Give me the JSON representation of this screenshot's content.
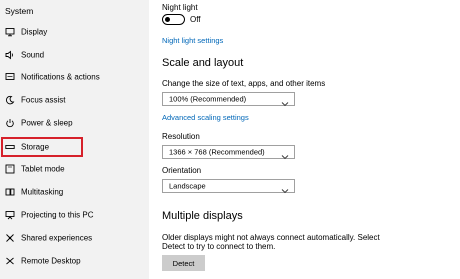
{
  "sidebar": {
    "title": "System",
    "items": [
      {
        "label": "Display",
        "icon": "display-icon"
      },
      {
        "label": "Sound",
        "icon": "sound-icon"
      },
      {
        "label": "Notifications & actions",
        "icon": "notifications-icon"
      },
      {
        "label": "Focus assist",
        "icon": "focus-assist-icon"
      },
      {
        "label": "Power & sleep",
        "icon": "power-icon"
      },
      {
        "label": "Storage",
        "icon": "storage-icon"
      },
      {
        "label": "Tablet mode",
        "icon": "tablet-icon"
      },
      {
        "label": "Multitasking",
        "icon": "multitasking-icon"
      },
      {
        "label": "Projecting to this PC",
        "icon": "projecting-icon"
      },
      {
        "label": "Shared experiences",
        "icon": "shared-experiences-icon"
      },
      {
        "label": "Remote Desktop",
        "icon": "remote-desktop-icon"
      }
    ],
    "highlighted_item": "Storage",
    "highlight_color": "#d6202a"
  },
  "main": {
    "night_light": {
      "label": "Night light",
      "toggle_state": "Off",
      "settings_link": "Night light settings"
    },
    "scale_layout": {
      "heading": "Scale and layout",
      "scale_label": "Change the size of text, apps, and other items",
      "scale_value": "100% (Recommended)",
      "advanced_link": "Advanced scaling settings",
      "resolution_label": "Resolution",
      "resolution_value": "1366 × 768 (Recommended)",
      "orientation_label": "Orientation",
      "orientation_value": "Landscape"
    },
    "multiple_displays": {
      "heading": "Multiple displays",
      "description_line1": "Older displays might not always connect automatically. Select",
      "description_line2": "Detect to try to connect to them.",
      "detect_button": "Detect"
    }
  },
  "colors": {
    "link": "#0067b8",
    "sidebar_bg": "#f2f2f2",
    "button_bg": "#cccccc"
  }
}
